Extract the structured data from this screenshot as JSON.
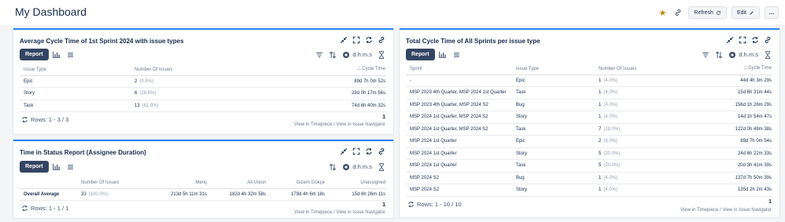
{
  "header": {
    "title": "My Dashboard",
    "refresh_label": "Refresh",
    "edit_label": "Edit",
    "more_label": "…"
  },
  "colors": {
    "accent": "#2684ff",
    "report_btn": "#344563",
    "star": "#b8860b"
  },
  "icons": [
    "star-icon",
    "link-icon",
    "refresh-icon",
    "pencil-icon",
    "more-icon",
    "collapse-icon",
    "fullscreen-icon",
    "sync-icon",
    "chart-icon",
    "list-icon",
    "filter-icon",
    "sort-icon",
    "eye-icon",
    "hourglass-icon"
  ],
  "gadget1": {
    "title": "Average Cycle Time of 1st Sprint 2024 with issue types",
    "report_label": "Report",
    "unit_label": "d.h.m.s",
    "columns": [
      "Issue Type",
      "Number Of Issues",
      "Cycle Time"
    ],
    "rows": [
      {
        "type": "Epic",
        "count": "2",
        "pct": "(9.5%)",
        "time": "89d 7h 0m 52s"
      },
      {
        "type": "Story",
        "count": "6",
        "pct": "(28.6%)",
        "time": "23d 0h 17m 56s"
      },
      {
        "type": "Task",
        "count": "13",
        "pct": "(61.9%)",
        "time": "74d 6h 40m 32s"
      }
    ],
    "rows_info": "Rows: 1 - 3 / 3",
    "page": "1",
    "footer": "View in Timepiece / View in Issue Navigator"
  },
  "gadget2": {
    "title": "Time in Status Report (Assignee Duration)",
    "report_label": "Report",
    "unit_label": "d.h.m.s",
    "columns": [
      "",
      "Number Of Issues",
      "Meriç",
      "Ali Uslun",
      "Gizem Gökçe",
      "Unassigned"
    ],
    "row": {
      "label": "Overall Average",
      "count": "33",
      "pct": "(100.0%)",
      "c1": "213d 5h 11m 31s",
      "c2": "182d 4h 32m 58s",
      "c3": "179d 4h 6m 18s",
      "c4": "15d 6h 26m 11s"
    },
    "rows_info": "Rows: 1 - 1 / 1",
    "page": "1",
    "footer": "View in Timepiece / View in Issue Navigator"
  },
  "gadget3": {
    "title": "Total Cycle Time of All Sprints per issue type",
    "report_label": "Report",
    "unit_label": "d.h.m.s",
    "columns": [
      "Sprint",
      "Issue Type",
      "Number Of Issues",
      "Cycle Time"
    ],
    "rows": [
      {
        "sprint": "-",
        "type": "Epic",
        "count": "1",
        "pct": "(4.0%)",
        "time": "44d 4h 3m 29s"
      },
      {
        "sprint": "MSP 2023 4th Quarter, MSP 2024 1st Quarter",
        "type": "Task",
        "count": "1",
        "pct": "(4.0%)",
        "time": "15d 6h 31m 44s"
      },
      {
        "sprint": "MSP 2023 4th Quarter, MSP 2024 S2",
        "type": "Bug",
        "count": "1",
        "pct": "(4.0%)",
        "time": "156d 1h 26m 29s"
      },
      {
        "sprint": "MSP 2024 1st Quarter, MSP 2024 S2",
        "type": "Story",
        "count": "1",
        "pct": "(4.0%)",
        "time": "14d 1h 54m 47s"
      },
      {
        "sprint": "MSP 2024 1st Quarter, MSP 2024 S2",
        "type": "Task",
        "count": "7",
        "pct": "(28.0%)",
        "time": "122d 0h 49m 38s"
      },
      {
        "sprint": "MSP 2024 1st Quarter",
        "type": "Epic",
        "count": "2",
        "pct": "(8.0%)",
        "time": "89d 7h 0m 54s"
      },
      {
        "sprint": "MSP 2024 1st Quarter",
        "type": "Story",
        "count": "5",
        "pct": "(20.0%)",
        "time": "24d 6h 22m 33s"
      },
      {
        "sprint": "MSP 2024 1st Quarter",
        "type": "Task",
        "count": "5",
        "pct": "(20.0%)",
        "time": "20d 3h 41m 39s"
      },
      {
        "sprint": "MSP 2024 S2",
        "type": "Bug",
        "count": "1",
        "pct": "(4.0%)",
        "time": "137d 7h 50m 39s"
      },
      {
        "sprint": "MSP 2024 S2",
        "type": "Story",
        "count": "1",
        "pct": "(4.0%)",
        "time": "135d 2h 2m 43s"
      }
    ],
    "rows_info": "Rows: 1 - 10 / 10",
    "page": "1",
    "footer": "View in Timepiece / View in Issue Navigator"
  }
}
